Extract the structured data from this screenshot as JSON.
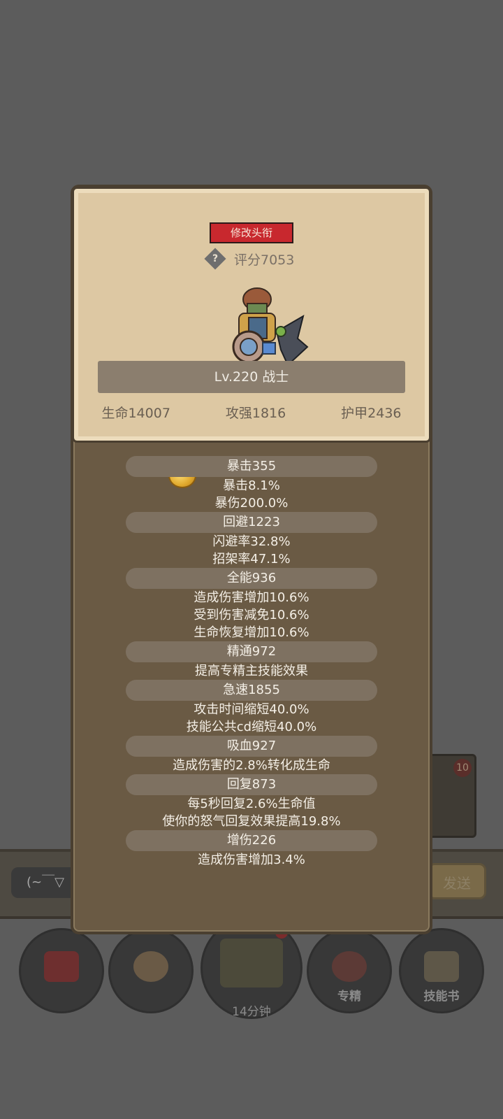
{
  "panel": {
    "title_button": "修改头衔",
    "score": "评分7053",
    "level_class": "Lv.220 战士",
    "core_stats": [
      "生命14007",
      "攻强1816",
      "护甲2436"
    ]
  },
  "stats": [
    {
      "header": "暴击355",
      "lines": [
        "暴击8.1%",
        "暴伤200.0%"
      ]
    },
    {
      "header": "回避1223",
      "lines": [
        "闪避率32.8%",
        "招架率47.1%"
      ]
    },
    {
      "header": "全能936",
      "lines": [
        "造成伤害增加10.6%",
        "受到伤害减免10.6%",
        "生命恢复增加10.6%"
      ]
    },
    {
      "header": "精通972",
      "lines": [
        "提高专精主技能效果"
      ]
    },
    {
      "header": "急速1855",
      "lines": [
        "攻击时间缩短40.0%",
        "技能公共cd缩短40.0%"
      ]
    },
    {
      "header": "吸血927",
      "lines": [
        "造成伤害的2.8%转化成生命"
      ]
    },
    {
      "header": "回复873",
      "lines": [
        "每5秒回复2.6%生命值",
        "使你的怒气回复效果提高19.8%"
      ]
    },
    {
      "header": "增伤226",
      "lines": [
        "造成伤害增加3.4%"
      ]
    }
  ],
  "background": {
    "chat_input": "(~￣▽",
    "send_label": "发送",
    "side_card_badge": "10",
    "nav": [
      {
        "label": "",
        "icon": "potion-icon"
      },
      {
        "label": "",
        "icon": "bread-icon"
      },
      {
        "label": "14分钟",
        "icon": "chest-icon",
        "badge": "!"
      },
      {
        "label": "专精",
        "icon": "specialization-icon"
      },
      {
        "label": "技能书",
        "icon": "skill-book-icon"
      }
    ]
  }
}
